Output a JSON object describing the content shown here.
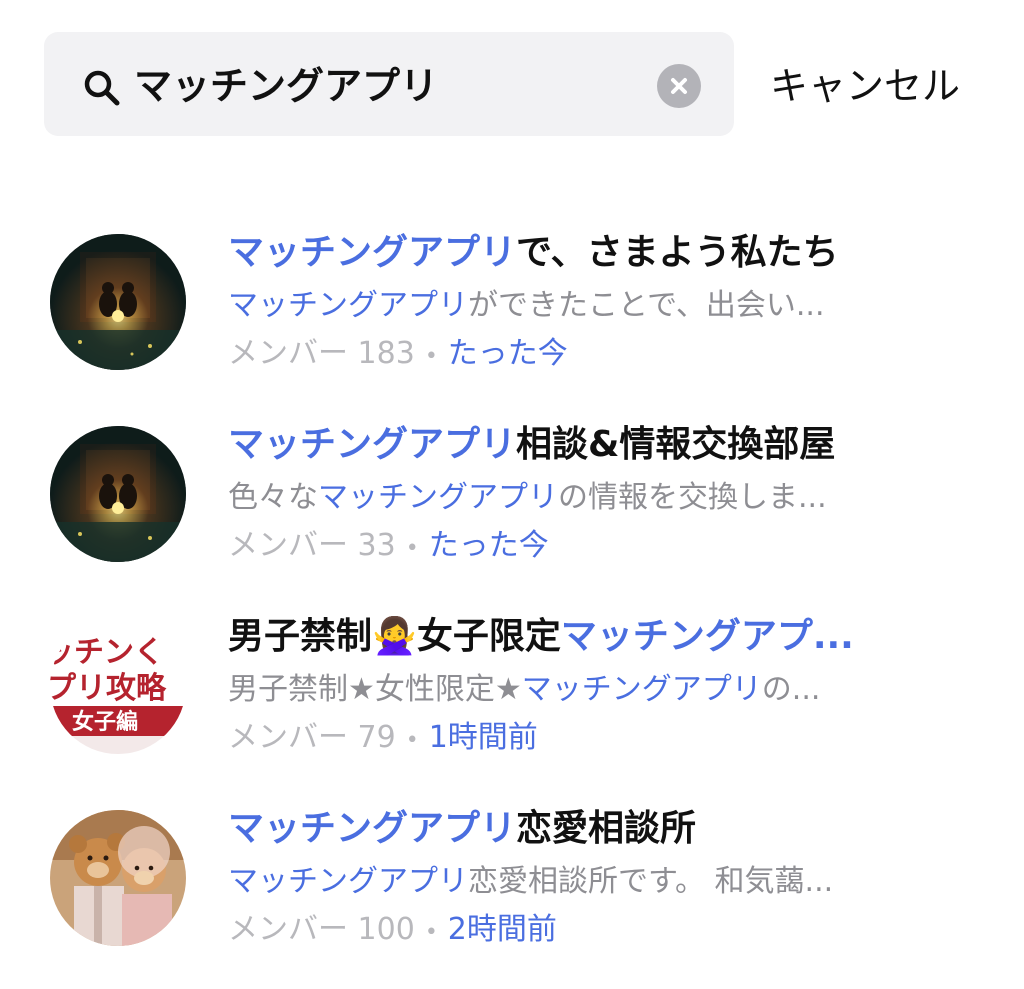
{
  "search": {
    "query": "マッチングアプリ",
    "cancel_label": "キャンセル"
  },
  "results": [
    {
      "title_hl": "マッチングアプリ",
      "title_rest": "で、さまよう私たち",
      "title_pre": "",
      "desc_pre": "",
      "desc_hl": "マッチングアプリ",
      "desc_rest": "ができたことで、出会い...",
      "member_label": "メンバー",
      "member_count": "183",
      "time": "たった今",
      "avatar_icon": "night-couple-avatar"
    },
    {
      "title_hl": "マッチングアプリ",
      "title_rest": "相談&情報交換部屋",
      "title_pre": "",
      "desc_pre": "色々な",
      "desc_hl": "マッチングアプリ",
      "desc_rest": "の情報を交換しま...",
      "member_label": "メンバー",
      "member_count": "33",
      "time": "たった今",
      "avatar_icon": "night-couple-avatar"
    },
    {
      "title_pre": "男子禁制🙅‍♀️女子限定",
      "title_hl": "マッチングアプ...",
      "title_rest": "",
      "desc_pre": "男子禁制★女性限定★",
      "desc_hl": "マッチングアプリ",
      "desc_rest": "の...",
      "member_label": "メンバー",
      "member_count": "79",
      "time": "1時間前",
      "avatar_icon": "text-logo-avatar",
      "avatar_text_1": "ッチンく",
      "avatar_text_2": "プリ攻略",
      "avatar_text_3": "女子編"
    },
    {
      "title_hl": "マッチングアプリ",
      "title_rest": "恋愛相談所",
      "title_pre": "",
      "desc_pre": "",
      "desc_hl": "マッチングアプリ",
      "desc_rest": "恋愛相談所です。 和気藹...",
      "member_label": "メンバー",
      "member_count": "100",
      "time": "2時間前",
      "avatar_icon": "teddy-bears-avatar"
    }
  ],
  "colors": {
    "highlight": "#4a6ee0",
    "search_bg": "#f2f2f4",
    "meta_gray": "#b8b8bc",
    "desc_gray": "#8e8e93"
  }
}
